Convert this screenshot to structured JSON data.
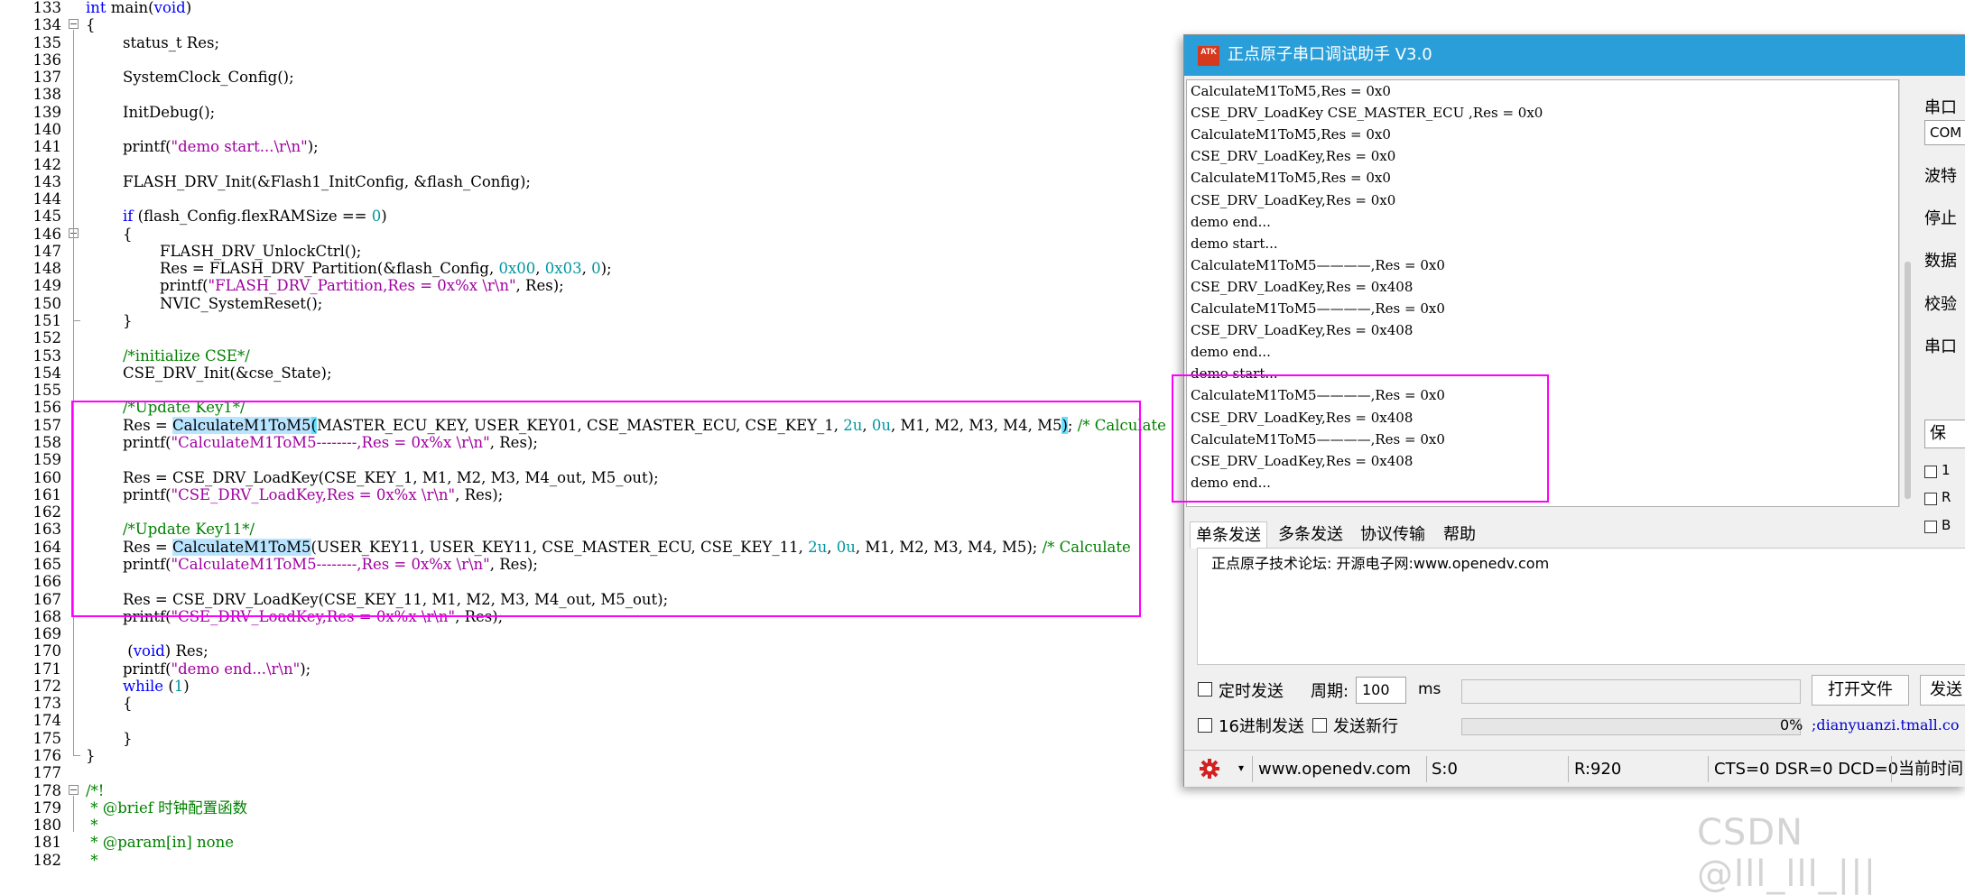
{
  "editor": {
    "lines": [
      {
        "n": "133",
        "t": [
          [
            "int",
            "kw"
          ],
          [
            " main("
          ],
          [
            "void",
            "kw"
          ],
          [
            ")"
          ]
        ],
        "x": 0
      },
      {
        "n": "134",
        "t": [
          [
            "{"
          ]
        ],
        "x": 0
      },
      {
        "n": "135",
        "t": [
          [
            "status_t Res;"
          ]
        ],
        "x": 1
      },
      {
        "n": "136",
        "t": [],
        "x": 1
      },
      {
        "n": "137",
        "t": [
          [
            "SystemClock_Config();"
          ]
        ],
        "x": 1
      },
      {
        "n": "138",
        "t": [],
        "x": 1
      },
      {
        "n": "139",
        "t": [
          [
            "InitDebug();"
          ]
        ],
        "x": 1
      },
      {
        "n": "140",
        "t": [],
        "x": 1
      },
      {
        "n": "141",
        "t": [
          [
            "printf("
          ],
          [
            "\"demo start...\\r\\n\"",
            "str"
          ],
          [
            ");"
          ]
        ],
        "x": 1
      },
      {
        "n": "142",
        "t": [],
        "x": 1
      },
      {
        "n": "143",
        "t": [
          [
            "FLASH_DRV_Init(&Flash1_InitConfig, &flash_Config);"
          ]
        ],
        "x": 1
      },
      {
        "n": "144",
        "t": [],
        "x": 1
      },
      {
        "n": "145",
        "t": [
          [
            "if",
            "kw"
          ],
          [
            " (flash_Config.flexRAMSize == "
          ],
          [
            "0",
            "num"
          ],
          [
            ")"
          ]
        ],
        "x": 1
      },
      {
        "n": "146",
        "t": [
          [
            "{"
          ]
        ],
        "x": 1
      },
      {
        "n": "147",
        "t": [
          [
            "FLASH_DRV_UnlockCtrl();"
          ]
        ],
        "x": 2
      },
      {
        "n": "148",
        "t": [
          [
            "Res = FLASH_DRV_Partition(&flash_Config, "
          ],
          [
            "0x00",
            "num"
          ],
          [
            ", "
          ],
          [
            "0x03",
            "num"
          ],
          [
            ", "
          ],
          [
            "0",
            "num"
          ],
          [
            ");"
          ]
        ],
        "x": 2
      },
      {
        "n": "149",
        "t": [
          [
            "printf("
          ],
          [
            "\"FLASH_DRV_Partition,Res = 0x%x \\r\\n\"",
            "str"
          ],
          [
            ", Res);"
          ]
        ],
        "x": 2
      },
      {
        "n": "150",
        "t": [
          [
            "NVIC_SystemReset();"
          ]
        ],
        "x": 2
      },
      {
        "n": "151",
        "t": [
          [
            "}"
          ]
        ],
        "x": 1
      },
      {
        "n": "152",
        "t": [],
        "x": 1
      },
      {
        "n": "153",
        "t": [
          [
            "/*initialize CSE*/",
            "cmt"
          ]
        ],
        "x": 1
      },
      {
        "n": "154",
        "t": [
          [
            "CSE_DRV_Init(&cse_State);"
          ]
        ],
        "x": 1
      },
      {
        "n": "155",
        "t": [],
        "x": 1
      },
      {
        "n": "156",
        "t": [
          [
            "/*Update Key1*/",
            "cmt"
          ]
        ],
        "x": 1
      },
      {
        "n": "157",
        "t": [
          [
            "Res = "
          ],
          [
            "CalculateM1ToM5",
            "hl"
          ],
          [
            "(",
            "bracehl"
          ],
          [
            "MASTER_ECU_KEY, USER_KEY01, CSE_MASTER_ECU, CSE_KEY_1, "
          ],
          [
            "2u",
            "num"
          ],
          [
            ", "
          ],
          [
            "0u",
            "num"
          ],
          [
            ", M1, M2, M3, M4, M5"
          ],
          [
            ")",
            "bracehl"
          ],
          [
            "; "
          ],
          [
            "/* Calculate",
            "cmt"
          ]
        ],
        "x": 1
      },
      {
        "n": "158",
        "t": [
          [
            "printf("
          ],
          [
            "\"CalculateM1ToM5--------,Res = 0x%x \\r\\n\"",
            "str"
          ],
          [
            ", Res);"
          ]
        ],
        "x": 1
      },
      {
        "n": "159",
        "t": [],
        "x": 1
      },
      {
        "n": "160",
        "t": [
          [
            "Res = CSE_DRV_LoadKey(CSE_KEY_1, M1, M2, M3, M4_out, M5_out);"
          ]
        ],
        "x": 1
      },
      {
        "n": "161",
        "t": [
          [
            "printf("
          ],
          [
            "\"CSE_DRV_LoadKey,Res = 0x%x \\r\\n\"",
            "str"
          ],
          [
            ", Res);"
          ]
        ],
        "x": 1
      },
      {
        "n": "162",
        "t": [],
        "x": 1
      },
      {
        "n": "163",
        "t": [
          [
            "/*Update Key11*/",
            "cmt"
          ]
        ],
        "x": 1
      },
      {
        "n": "164",
        "t": [
          [
            "Res = "
          ],
          [
            "CalculateM1ToM5",
            "hl"
          ],
          [
            "(USER_KEY11, USER_KEY11, CSE_MASTER_ECU, CSE_KEY_11, "
          ],
          [
            "2u",
            "num"
          ],
          [
            ", "
          ],
          [
            "0u",
            "num"
          ],
          [
            ", M1, M2, M3, M4, M5); "
          ],
          [
            "/* Calculate",
            "cmt"
          ]
        ],
        "x": 1
      },
      {
        "n": "165",
        "t": [
          [
            "printf("
          ],
          [
            "\"CalculateM1ToM5--------,Res = 0x%x \\r\\n\"",
            "str"
          ],
          [
            ", Res);"
          ]
        ],
        "x": 1
      },
      {
        "n": "166",
        "t": [],
        "x": 1
      },
      {
        "n": "167",
        "t": [
          [
            "Res = CSE_DRV_LoadKey(CSE_KEY_11, M1, M2, M3, M4_out, M5_out);"
          ]
        ],
        "x": 1
      },
      {
        "n": "168",
        "t": [
          [
            "printf("
          ],
          [
            "\"CSE_DRV_LoadKey,Res = 0x%x \\r\\n\"",
            "str"
          ],
          [
            ", Res);"
          ]
        ],
        "x": 1
      },
      {
        "n": "169",
        "t": [],
        "x": 1
      },
      {
        "n": "170",
        "t": [
          [
            " ("
          ],
          [
            "void",
            "kw"
          ],
          [
            ") Res;"
          ]
        ],
        "x": 1
      },
      {
        "n": "171",
        "t": [
          [
            "printf("
          ],
          [
            "\"demo end...\\r\\n\"",
            "str"
          ],
          [
            ");"
          ]
        ],
        "x": 1
      },
      {
        "n": "172",
        "t": [
          [
            "while",
            "kw"
          ],
          [
            " ("
          ],
          [
            "1",
            "num"
          ],
          [
            ")"
          ]
        ],
        "x": 1
      },
      {
        "n": "173",
        "t": [
          [
            "{"
          ]
        ],
        "x": 1
      },
      {
        "n": "174",
        "t": [],
        "x": 1
      },
      {
        "n": "175",
        "t": [
          [
            "}"
          ]
        ],
        "x": 1
      },
      {
        "n": "176",
        "t": [
          [
            "}"
          ]
        ],
        "x": 0
      },
      {
        "n": "177",
        "t": [],
        "x": 0
      },
      {
        "n": "178",
        "t": [
          [
            "/*!",
            "cmt"
          ]
        ],
        "x": 0
      },
      {
        "n": "179",
        "t": [
          [
            " * ",
            "cmt"
          ],
          [
            "@brief",
            "cmt"
          ],
          [
            " 时钟配置函数",
            "cmt"
          ]
        ],
        "x": 0
      },
      {
        "n": "180",
        "t": [
          [
            " *",
            "cmt"
          ]
        ],
        "x": 0
      },
      {
        "n": "181",
        "t": [
          [
            " * ",
            "cmt"
          ],
          [
            "@param[in] none",
            "cmt"
          ]
        ],
        "x": 0
      },
      {
        "n": "182",
        "t": [
          [
            " *",
            "cmt"
          ]
        ],
        "x": 0
      }
    ]
  },
  "serial": {
    "title": "正点原子串口调试助手 V3.0",
    "logo": "ATK",
    "receive_lines": [
      "CalculateM1ToM5,Res = 0x0",
      "CSE_DRV_LoadKey CSE_MASTER_ECU ,Res = 0x0",
      "CalculateM1ToM5,Res = 0x0",
      "CSE_DRV_LoadKey,Res = 0x0",
      "CalculateM1ToM5,Res = 0x0",
      "CSE_DRV_LoadKey,Res = 0x0",
      "demo end...",
      "demo start...",
      "CalculateM1ToM5————,Res = 0x0",
      "CSE_DRV_LoadKey,Res = 0x408",
      "CalculateM1ToM5————,Res = 0x0",
      "CSE_DRV_LoadKey,Res = 0x408",
      "demo end...",
      "demo start...",
      "CalculateM1ToM5————,Res = 0x0",
      "CSE_DRV_LoadKey,Res = 0x408",
      "CalculateM1ToM5————,Res = 0x0",
      "CSE_DRV_LoadKey,Res = 0x408",
      "demo end..."
    ],
    "right_panel": {
      "port_label": "串口",
      "port_value": "COM",
      "baud_label": "波特",
      "stop_label": "停止",
      "data_label": "数据",
      "parity_label": "校验",
      "op_label": "串口",
      "save_button": "保",
      "check1": "1",
      "check2": "R",
      "check3": "B"
    },
    "tabs": [
      "单条发送",
      "多条发送",
      "协议传输",
      "帮助"
    ],
    "send_text": "正点原子技术论坛: 开源电子网:www.openedv.com",
    "timed_send": "定时发送",
    "period_label": "周期:",
    "period_value": "100",
    "period_unit": "ms",
    "open_file": "打开文件",
    "send_button": "发送",
    "hex_send": "16进制发送",
    "newline_send": "发送新行",
    "progress_text": "0%",
    "link_text": ";dianyuanzi.tmall.co",
    "status": {
      "website": "www.openedv.com",
      "sent": "S:0",
      "received": "R:920",
      "signals": "CTS=0 DSR=0 DCD=0",
      "time_label": "当前时间"
    }
  },
  "watermark": "CSDN @lll_lll_|||"
}
